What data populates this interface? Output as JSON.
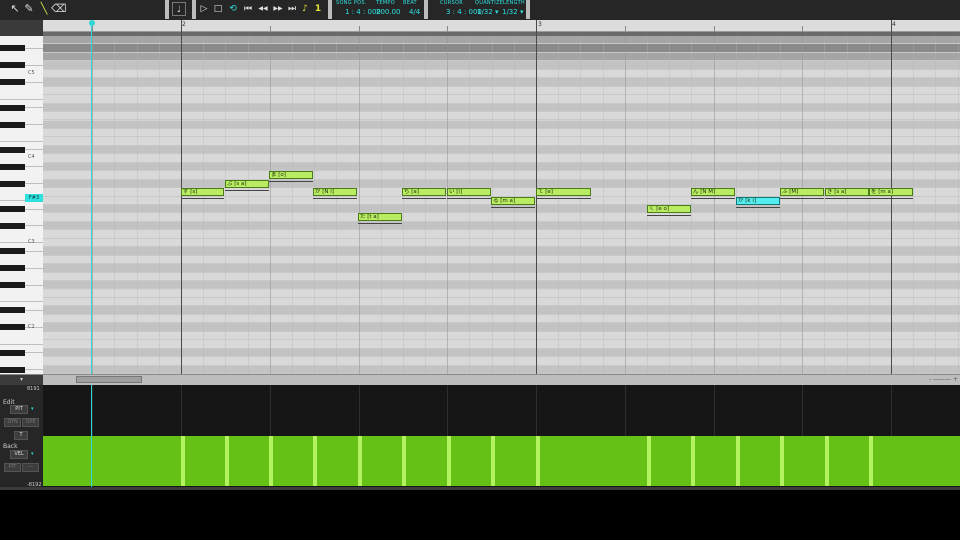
{
  "toolbar": {
    "tools": [
      {
        "name": "pointer-tool",
        "glyph": "↖"
      },
      {
        "name": "pencil-tool",
        "glyph": "✎"
      },
      {
        "name": "line-tool",
        "glyph": "╲"
      },
      {
        "name": "eraser-tool",
        "glyph": "⌫"
      }
    ],
    "transport": {
      "play": "▷",
      "stop": "□",
      "loop": "⟲",
      "rewind": "⏮",
      "back": "◀◀",
      "forward": "▶▶",
      "end": "⏭"
    },
    "headers": {
      "song_pos_label": "SONG POS.",
      "tempo_label": "TEMPO",
      "beat_label": "BEAT",
      "cursor_label": "CURSOR",
      "quantize_label": "QUANTIZE",
      "length_label": "LENGTH",
      "song_pos": "1 : 4 : 000",
      "tempo": "200.00",
      "beat": "4/4",
      "cursor": "3 : 4 : 000",
      "quantize": "1/32 ▾",
      "length": "1/32 ▾"
    },
    "metronome_icons": [
      "♪",
      "𝄞",
      "1"
    ]
  },
  "ruler": {
    "bars": [
      "2",
      "3",
      "4"
    ]
  },
  "keys": {
    "octaves": [
      "C5",
      "C4",
      "C3",
      "C2"
    ],
    "highlight_key": "F#3"
  },
  "notes": [
    {
      "label": "ず [s]",
      "selected": false
    },
    {
      "label": "ぶ [s a]",
      "selected": false
    },
    {
      "label": "ま [o]",
      "selected": false
    },
    {
      "label": "が [N i]",
      "selected": false
    },
    {
      "label": "た [t a]",
      "selected": false
    },
    {
      "label": "ち [a]",
      "selected": false
    },
    {
      "label": "い [i]",
      "selected": false
    },
    {
      "label": "る [m a]",
      "selected": false
    },
    {
      "label": "て [e]",
      "selected": false
    },
    {
      "label": "く [e o]",
      "selected": false
    },
    {
      "label": "ん [N M]",
      "selected": false
    },
    {
      "label": "が [k i]",
      "selected": false
    },
    {
      "label": "ふ [M]",
      "selected": false
    },
    {
      "label": "き [s a]",
      "selected": false
    },
    {
      "label": "を [m a]",
      "selected": false
    }
  ],
  "lower": {
    "max_value": "8191",
    "min_value": "-8192",
    "edit_label": "Edit",
    "edit_param": "PIT",
    "dyn_btn": "DYN",
    "ope_btn": "OPE",
    "t_btn": "T",
    "back_label": "Back",
    "back_param": "VEL",
    "pit_btn": "PIT",
    "dash_btn": "---"
  },
  "scroll": {
    "zoom_label": "- ——— +"
  }
}
